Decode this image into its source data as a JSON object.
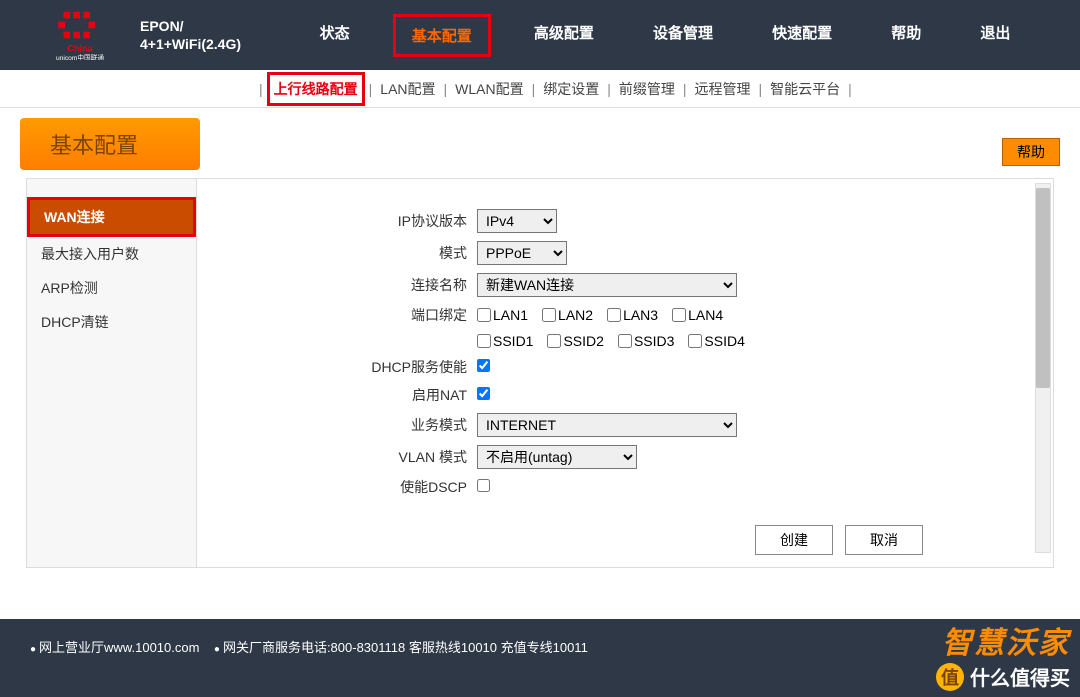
{
  "header": {
    "brand": "China unicom中国联通",
    "device_line1": "EPON/",
    "device_line2": "4+1+WiFi(2.4G)"
  },
  "topnav": [
    "状态",
    "基本配置",
    "高级配置",
    "设备管理",
    "快速配置",
    "帮助",
    "退出"
  ],
  "topnav_active_index": 1,
  "subnav": [
    "上行线路配置",
    "LAN配置",
    "WLAN配置",
    "绑定设置",
    "前缀管理",
    "远程管理",
    "智能云平台"
  ],
  "subnav_active_index": 0,
  "page_title": "基本配置",
  "help_button": "帮助",
  "sidebar": {
    "items": [
      "WAN连接",
      "最大接入用户数",
      "ARP检测",
      "DHCP清链"
    ],
    "active_index": 0
  },
  "form": {
    "labels": {
      "ip_version": "IP协议版本",
      "mode": "模式",
      "conn_name": "连接名称",
      "port_binding": "端口绑定",
      "dhcp_enable": "DHCP服务使能",
      "nat_enable": "启用NAT",
      "service_mode": "业务模式",
      "vlan_mode": "VLAN 模式",
      "dscp_enable": "使能DSCP"
    },
    "values": {
      "ip_version": "IPv4",
      "mode": "PPPoE",
      "conn_name": "新建WAN连接",
      "service_mode": "INTERNET",
      "vlan_mode": "不启用(untag)",
      "dhcp_checked": true,
      "nat_checked": true,
      "dscp_checked": false
    },
    "port_lan": [
      "LAN1",
      "LAN2",
      "LAN3",
      "LAN4"
    ],
    "port_ssid": [
      "SSID1",
      "SSID2",
      "SSID3",
      "SSID4"
    ]
  },
  "buttons": {
    "create": "创建",
    "cancel": "取消"
  },
  "footer": {
    "left1": "网上营业厅www.10010.com",
    "left2": "网关厂商服务电话:800-8301118 客服热线10010 充值专线10011"
  },
  "watermark": {
    "top": "智慧沃家",
    "bottom": "什么值得买",
    "badge": "值"
  }
}
